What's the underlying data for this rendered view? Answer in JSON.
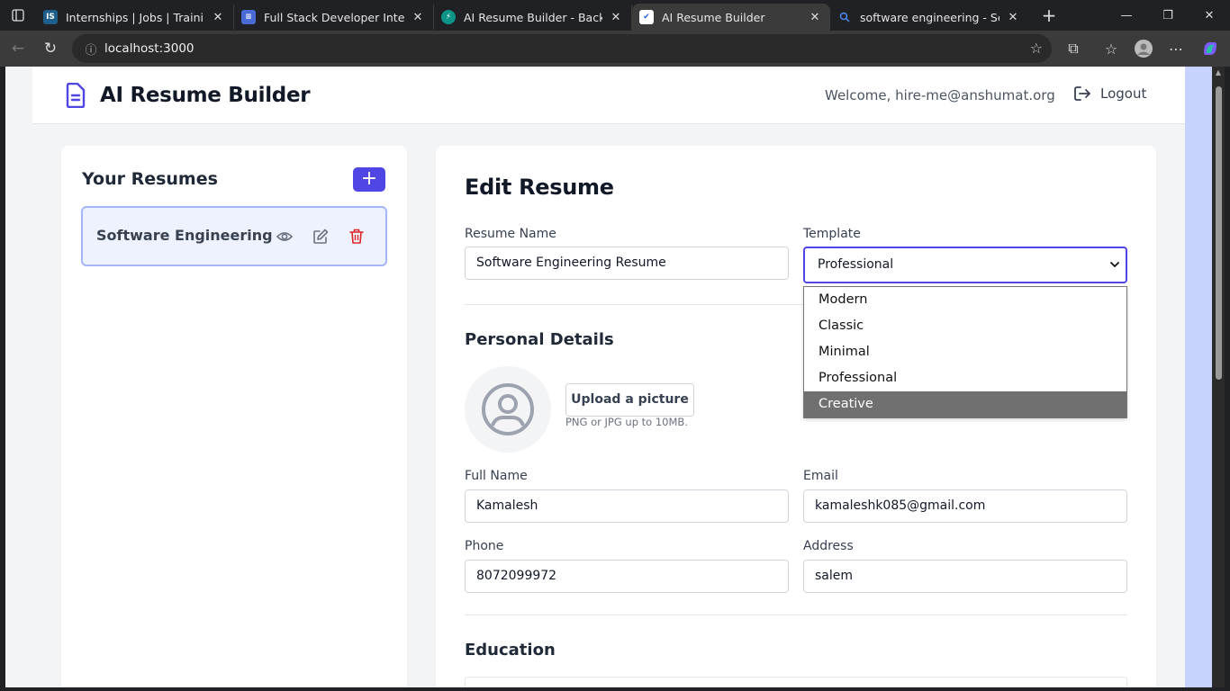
{
  "browser": {
    "tabs": [
      {
        "title": "Internships | Jobs | Trainings & Courses",
        "favicon_text": "IS",
        "favicon_color": "#1e5e8a"
      },
      {
        "title": "Full Stack Developer Internship",
        "favicon_text": "≡",
        "favicon_color": "#4a6bd6"
      },
      {
        "title": "AI Resume Builder - Backend - Replit",
        "favicon_text": "⚡",
        "favicon_color": "#0d9488"
      },
      {
        "title": "AI Resume Builder",
        "favicon_text": "✔",
        "favicon_color": "#ffffff"
      },
      {
        "title": "software engineering - Search",
        "favicon_text": "🔍",
        "favicon_color": "#202124"
      }
    ],
    "active_tab_index": 3,
    "url": "localhost:3000"
  },
  "header": {
    "app_title": "AI Resume Builder",
    "welcome": "Welcome, hire-me@anshumat.org",
    "logout_label": "Logout",
    "accent": "#4f46e5"
  },
  "sidebar": {
    "title": "Your Resumes",
    "add_label": "+",
    "resumes": [
      {
        "name": "Software Engineering Resume",
        "display_name": "Software Engineering ..."
      }
    ]
  },
  "editor": {
    "title": "Edit Resume",
    "resume_name_label": "Resume Name",
    "resume_name_value": "Software Engineering Resume",
    "template_label": "Template",
    "template_value": "Professional",
    "template_options": [
      "Modern",
      "Classic",
      "Minimal",
      "Professional",
      "Creative"
    ],
    "highlighted_option": "Creative",
    "personal_details_title": "Personal Details",
    "upload_label": "Upload a picture",
    "upload_hint": "PNG or JPG up to 10MB.",
    "full_name_label": "Full Name",
    "full_name_value": "Kamalesh",
    "email_label": "Email",
    "email_value": "kamaleshk085@gmail.com",
    "phone_label": "Phone",
    "phone_value": "8072099972",
    "address_label": "Address",
    "address_value": "salem",
    "education_title": "Education"
  }
}
